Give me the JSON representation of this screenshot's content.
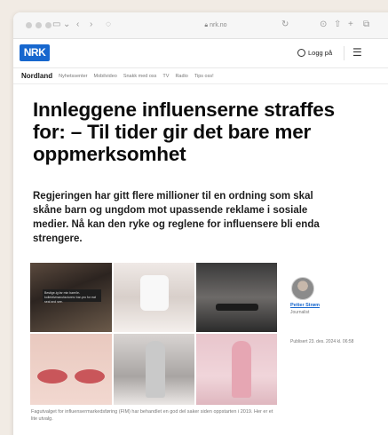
{
  "browser": {
    "url": "nrk.no"
  },
  "header": {
    "logo": "NRK",
    "login_label": "Logg på"
  },
  "subnav": {
    "region": "Nordland",
    "links": [
      "Nyhetssenter",
      "Mobilvideo",
      "Snakk med oss",
      "TV",
      "Radio",
      "Tips oss!"
    ]
  },
  "article": {
    "headline": "Innleggene influenserne straffes for: – Til tider gir det bare mer oppmerksomhet",
    "lead": "Regjeringen har gitt flere millioner til en ordning som skal skåne barn og ungdom mot upassende reklame i sosiale medier. Nå kan den ryke og reglene for influensere bli enda strengere.",
    "caption": "Fagutvalget for influensermarkedsføring (FIM) har behandlet en god del saker siden oppstarten i 2019. Her er et lite utvalg.",
    "image_overlay_text": "Bestige-ig far min bare/le-\nkollektivmanufacturerz bar-pro\nfor eat seal and see."
  },
  "author": {
    "name": "Petter Strøm",
    "role": "Journalist",
    "published": "Publisert 23. des. 2024 kl. 06:58"
  },
  "colors": {
    "nrk_blue": "#1767ce",
    "background": "#f1ebe4"
  }
}
